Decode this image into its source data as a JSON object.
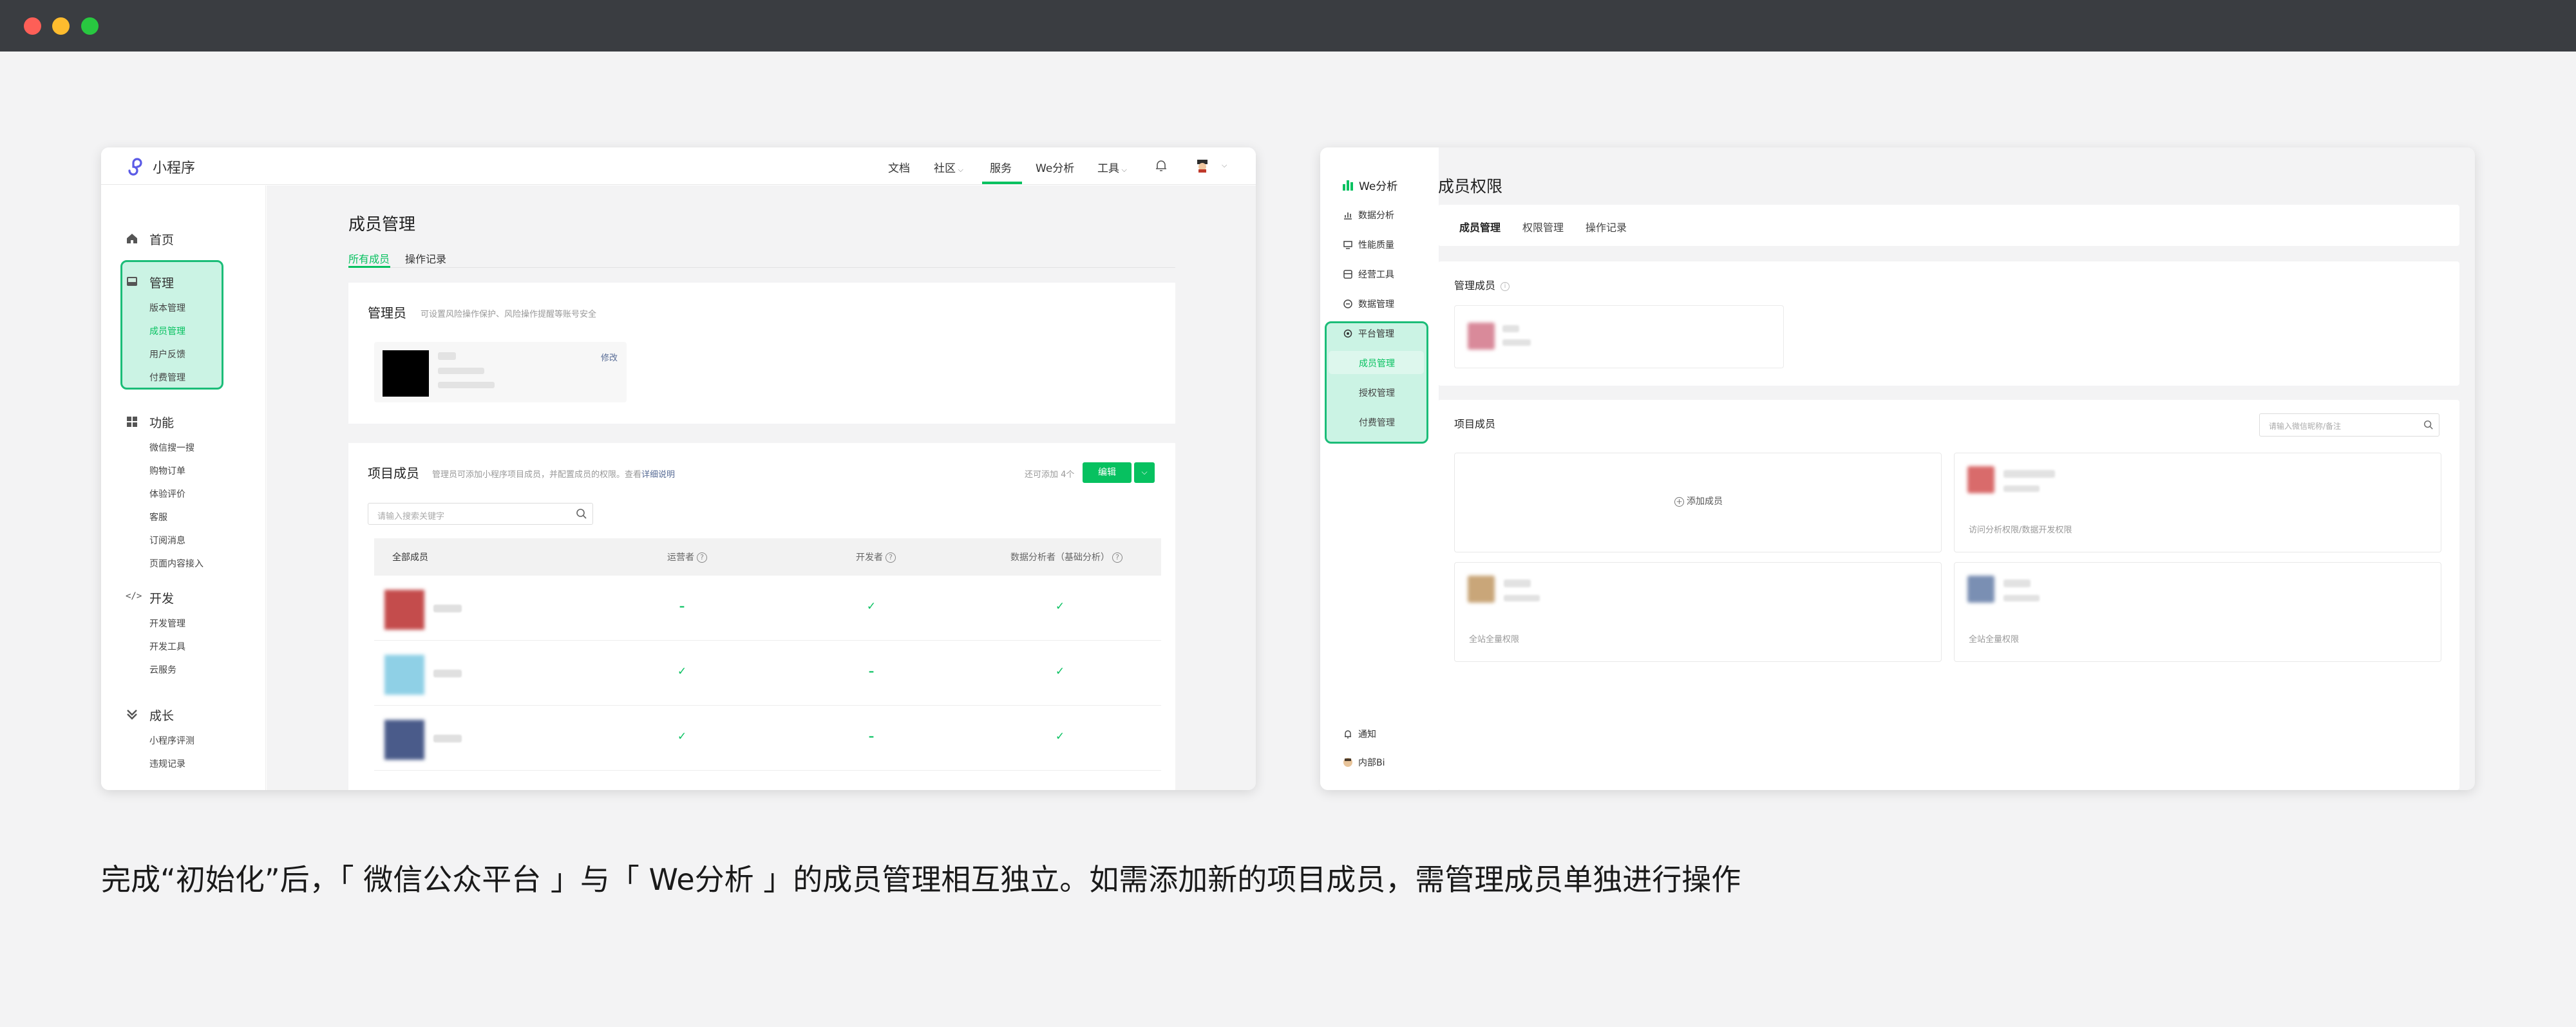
{
  "caption": "完成“初始化”后，「 微信公众平台 」与「 We分析 」的成员管理相互独立。如需添加新的项目成员，需管理成员单独进行操作",
  "left": {
    "logo_text": "小程序",
    "nav": [
      "文档",
      "社区",
      "服务",
      "We分析",
      "工具"
    ],
    "sidebar": {
      "home": "首页",
      "manage": {
        "title": "管理",
        "items": [
          "版本管理",
          "成员管理",
          "用户反馈",
          "付费管理"
        ]
      },
      "features": {
        "title": "功能",
        "items": [
          "微信搜一搜",
          "购物订单",
          "体验评价",
          "客服",
          "订阅消息",
          "页面内容接入"
        ]
      },
      "dev": {
        "title": "开发",
        "items": [
          "开发管理",
          "开发工具",
          "云服务"
        ]
      },
      "growth": {
        "title": "成长",
        "items": [
          "小程序评测",
          "违规记录"
        ]
      }
    },
    "page_title": "成员管理",
    "tabs": [
      "所有成员",
      "操作记录"
    ],
    "admin": {
      "title": "管理员",
      "desc": "可设置风险操作保护、风险操作提醒等账号安全",
      "edit": "修改"
    },
    "project": {
      "title": "项目成员",
      "desc": "管理员可添加小程序项目成员，并配置成员的权限。查看",
      "desc_link": "详细说明",
      "count": "还可添加 4个",
      "edit_btn": "编辑",
      "search_placeholder": "请输入搜索关键字",
      "columns": [
        "全部成员",
        "运营者",
        "开发者",
        "数据分析者（基础分析）"
      ],
      "rows": [
        {
          "ops": "–",
          "dev": "✓",
          "data": "✓",
          "color": "#c44c4c"
        },
        {
          "ops": "✓",
          "dev": "–",
          "data": "✓",
          "color": "#8fd0e6"
        },
        {
          "ops": "✓",
          "dev": "–",
          "data": "✓",
          "color": "#4a5b8a"
        }
      ]
    }
  },
  "right": {
    "logo_text": "We分析",
    "nav": [
      "数据分析",
      "性能质量",
      "经营工具",
      "数据管理",
      "平台管理"
    ],
    "nav_sub": [
      "成员管理",
      "授权管理",
      "付费管理"
    ],
    "bottom": [
      "通知",
      "内部Bi"
    ],
    "title": "成员权限",
    "tabs": [
      "成员管理",
      "权限管理",
      "操作记录"
    ],
    "admin_title": "管理成员",
    "members_title": "项目成员",
    "search_placeholder": "请输入微信昵称/备注",
    "add_member": "添加成员",
    "member_cards": [
      {
        "desc": "访问分析权限/数据开发权限",
        "color": "#d96b6b"
      },
      {
        "desc": "全站全量权限",
        "color": "#c9a679"
      },
      {
        "desc": "全站全量权限",
        "color": "#7a8fb3"
      }
    ]
  }
}
